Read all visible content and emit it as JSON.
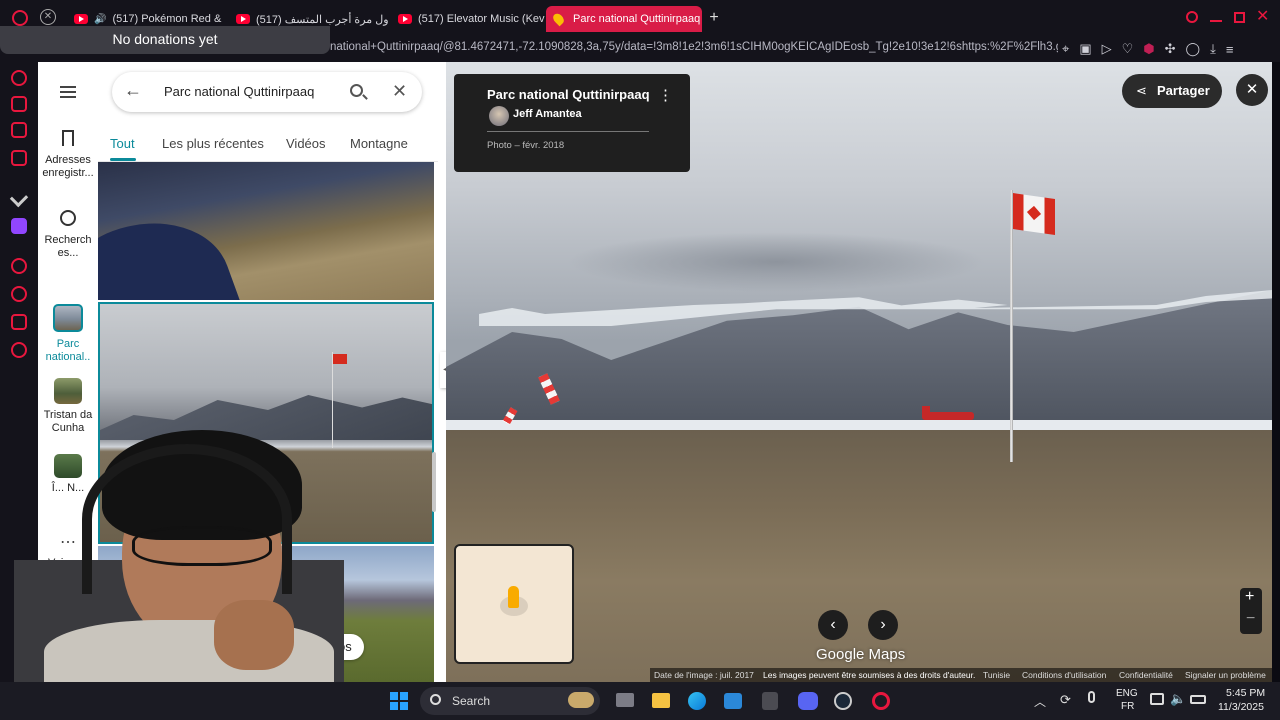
{
  "donation_overlay": "No donations yet",
  "tabs": [
    {
      "label": "(517) Pokémon Red &"
    },
    {
      "label": "(517) أول مرة أجرب المتسف"
    },
    {
      "label": "(517) Elevator Music (Kev"
    },
    {
      "label": "Parc national Quttinirpaaq"
    }
  ],
  "address": "national+Quttinirpaaq/@81.4672471,-72.1090828,3a,75y/data=!3m8!1e2!3m6!1sCIHM0ogKEICAgIDEosb_Tg!2e10!3e12!6shttps:%2F%2Flh3.go",
  "rail": {
    "saved": "Adresses enregistr...",
    "history": "Recherch es...",
    "recent1": "Parc national..",
    "recent2": "Tristan da Cunha",
    "recent3": "Î... N...",
    "more": "Voir..."
  },
  "search": {
    "value": "Parc national Quttinirpaaq"
  },
  "filters": [
    "Tout",
    "Les plus récentes",
    "Vidéos",
    "Montagne"
  ],
  "videos_chip": "vidéos",
  "info_card": {
    "title": "Parc national Quttinirpaaq",
    "author": "Jeff Amantea",
    "meta": "Photo – févr. 2018"
  },
  "share_label": "Partager",
  "footer": {
    "date": "Date de l'image : juil. 2017",
    "rights": "Les images peuvent être soumises à des droits d'auteur.",
    "country": "Tunisie",
    "terms": "Conditions d'utilisation",
    "privacy": "Confidentialité",
    "report": "Signaler un problème"
  },
  "brand": "Google Maps",
  "taskbar": {
    "search": "Search",
    "lang": "ENG",
    "lang2": "FR",
    "time": "5:45 PM",
    "date": "11/3/2025"
  },
  "colors": {
    "opera_red": "#e8173e",
    "tab_active": "#d91c47",
    "maps_teal": "#0b8a9a",
    "canada_red": "#d52b1e"
  }
}
